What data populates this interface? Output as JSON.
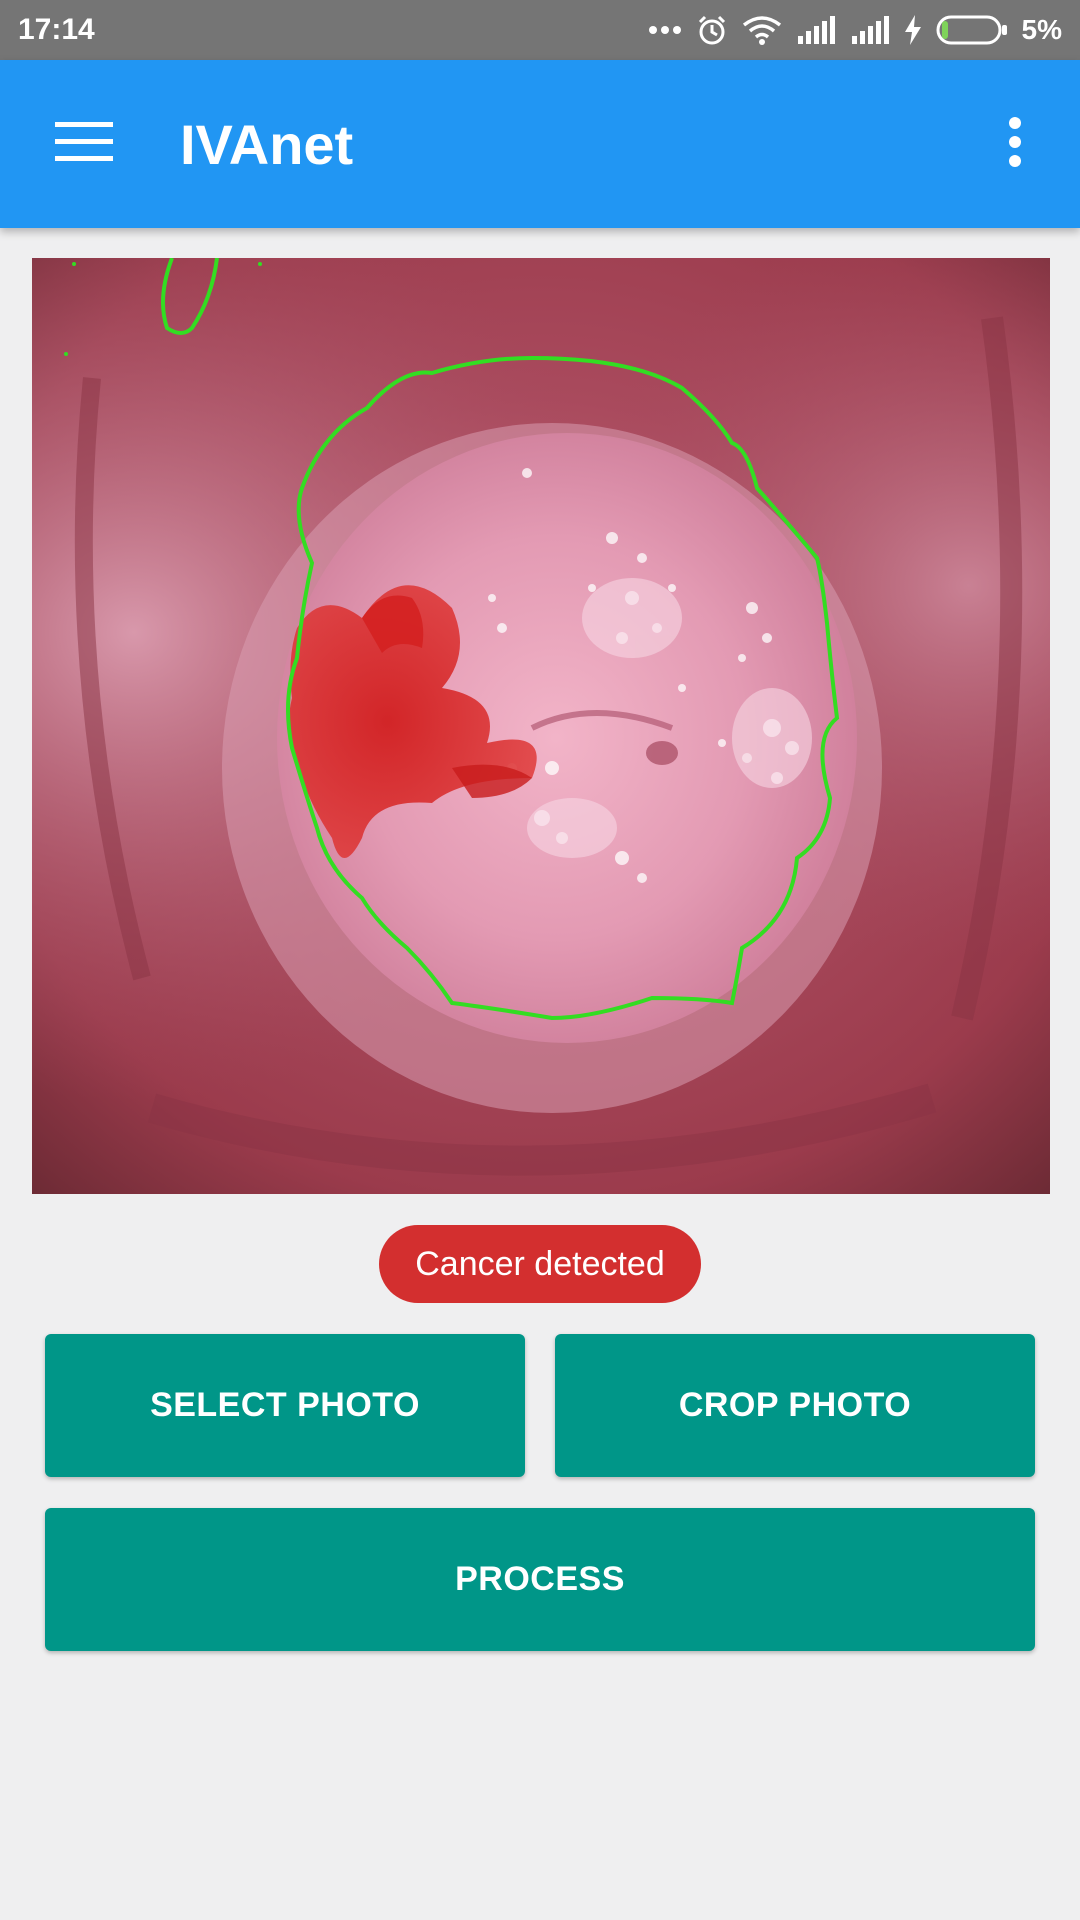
{
  "status_bar": {
    "time": "17:14",
    "battery_percent": "5%",
    "icons": [
      "more-dots-icon",
      "alarm-icon",
      "wifi-icon",
      "signal-icon",
      "signal-icon",
      "charging-icon",
      "battery-icon"
    ]
  },
  "app_bar": {
    "title": "IVAnet",
    "menu_icon": "hamburger-menu-icon",
    "overflow_icon": "more-vert-icon",
    "color": "#2196f3"
  },
  "image": {
    "subject": "cervix photo with detected region outline",
    "outline_color": "#33dd22"
  },
  "result": {
    "label": "Cancer detected",
    "color": "#d32f2f"
  },
  "buttons": {
    "select_photo": "SELECT PHOTO",
    "crop_photo": "CROP PHOTO",
    "process": "PROCESS",
    "color": "#009688"
  }
}
